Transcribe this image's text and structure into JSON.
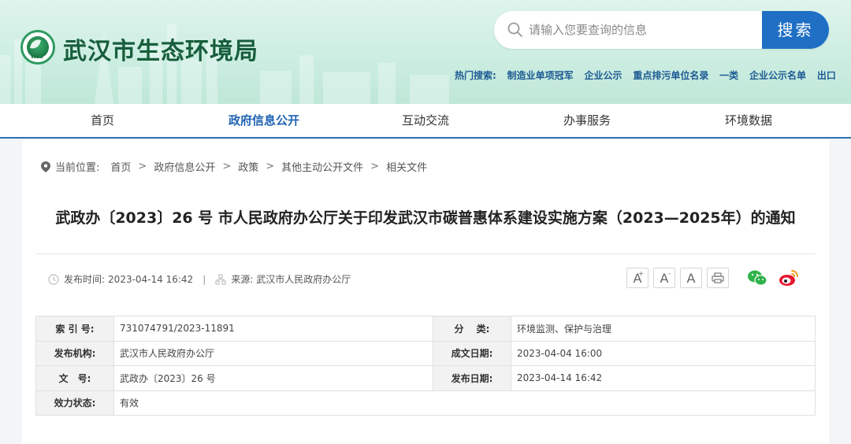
{
  "header": {
    "logo_text": "WEE",
    "site_title": "武汉市生态环境局",
    "search": {
      "placeholder": "请输入您要查询的信息",
      "button": "搜索"
    },
    "hot_search": {
      "label": "热门搜索:",
      "links": [
        "制造业单项冠军",
        "企业公示",
        "重点排污单位名录",
        "一类",
        "企业公示名单",
        "出口"
      ]
    }
  },
  "nav": [
    "首页",
    "政府信息公开",
    "互动交流",
    "办事服务",
    "环境数据"
  ],
  "breadcrumb": {
    "label": "当前位置:",
    "items": [
      "首页",
      "政府信息公开",
      "政策",
      "其他主动公开文件",
      "相关文件"
    ]
  },
  "article": {
    "title": "武政办〔2023〕26 号 市人民政府办公厅关于印发武汉市碳普惠体系建设实施方案（2023—2025年）的通知",
    "publish_time_label": "发布时间:",
    "publish_time": "2023-04-14 16:42",
    "source_label": "来源:",
    "source": "武汉市人民政府办公厅"
  },
  "tools": {
    "font_large": "A",
    "font_medium": "A",
    "font_small": "A"
  },
  "info_table": {
    "index_label": "索 引 号:",
    "index_value": "731074791/2023-11891",
    "category_label": "分　 类:",
    "category_value": "环境监测、保护与治理",
    "org_label": "发布机构:",
    "org_value": "武汉市人民政府办公厅",
    "created_label": "成文日期:",
    "created_value": "2023-04-04 16:00",
    "doc_label": "文　号:",
    "doc_value": "武政办〔2023〕26 号",
    "published_label": "发布日期:",
    "published_value": "2023-04-14 16:42",
    "status_label": "效力状态:",
    "status_value": "有效"
  },
  "colors": {
    "nav_active": "#2164b3",
    "search_button": "#1f6fc5",
    "title_green": "#175e3c"
  }
}
